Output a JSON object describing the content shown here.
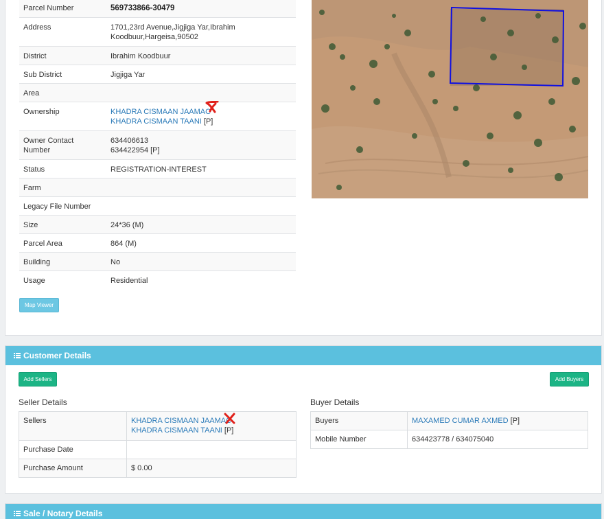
{
  "parcel": {
    "rows": [
      {
        "label": "Parcel Number",
        "value": "569733866-30479"
      },
      {
        "label": "Address",
        "line1": "1701,23rd Avenue,Jigjiga Yar,Ibrahim",
        "line2": "Koodbuur,Hargeisa,90502"
      },
      {
        "label": "District",
        "value": "Ibrahim Koodbuur"
      },
      {
        "label": "Sub District",
        "value": "Jigjiga Yar"
      },
      {
        "label": "Area",
        "value": ""
      },
      {
        "label": "Ownership",
        "owner1": "KHADRA CISMAAN JAAMAC",
        "owner2": "KHADRA CISMAAN TAANI",
        "owner2_suffix": "[P]"
      },
      {
        "label": "Owner Contact Number",
        "line1": "634406613",
        "line2": "634422954 [P]"
      },
      {
        "label": "Status",
        "value": "REGISTRATION-INTEREST"
      },
      {
        "label": "Farm",
        "value": ""
      },
      {
        "label": "Legacy File Number",
        "value": ""
      },
      {
        "label": "Size",
        "value": "24*36 (M)"
      },
      {
        "label": "Parcel Area",
        "value": "864 (M)"
      },
      {
        "label": "Building",
        "value": "No"
      },
      {
        "label": "Usage",
        "value": "Residential"
      }
    ],
    "map_viewer_label": "Map Viewer"
  },
  "customer": {
    "heading": "Customer Details",
    "add_sellers_label": "Add Sellers",
    "add_buyers_label": "Add Buyers",
    "seller_title": "Seller Details",
    "buyer_title": "Buyer Details",
    "sellers_label": "Sellers",
    "seller1": "KHADRA CISMAAN JAAMAC",
    "seller2": "KHADRA CISMAAN TAANI",
    "seller2_suffix": "[P]",
    "purchase_date_label": "Purchase Date",
    "purchase_date": "",
    "purchase_amount_label": "Purchase Amount",
    "purchase_amount": "$ 0.00",
    "buyers_label": "Buyers",
    "buyer1": "MAXAMED CUMAR AXMED",
    "buyer1_suffix": "[P]",
    "mobile_label": "Mobile Number",
    "mobile": "634423778 / 634075040"
  },
  "sale": {
    "heading": "Sale / Notary Details"
  },
  "colors": {
    "accent": "#5bc0de",
    "link": "#2a7ab8",
    "success": "#1cb485",
    "annotation": "#e0201a",
    "parcel_outline": "#1010e0"
  },
  "icons": {
    "section_icon": "list-icon"
  }
}
